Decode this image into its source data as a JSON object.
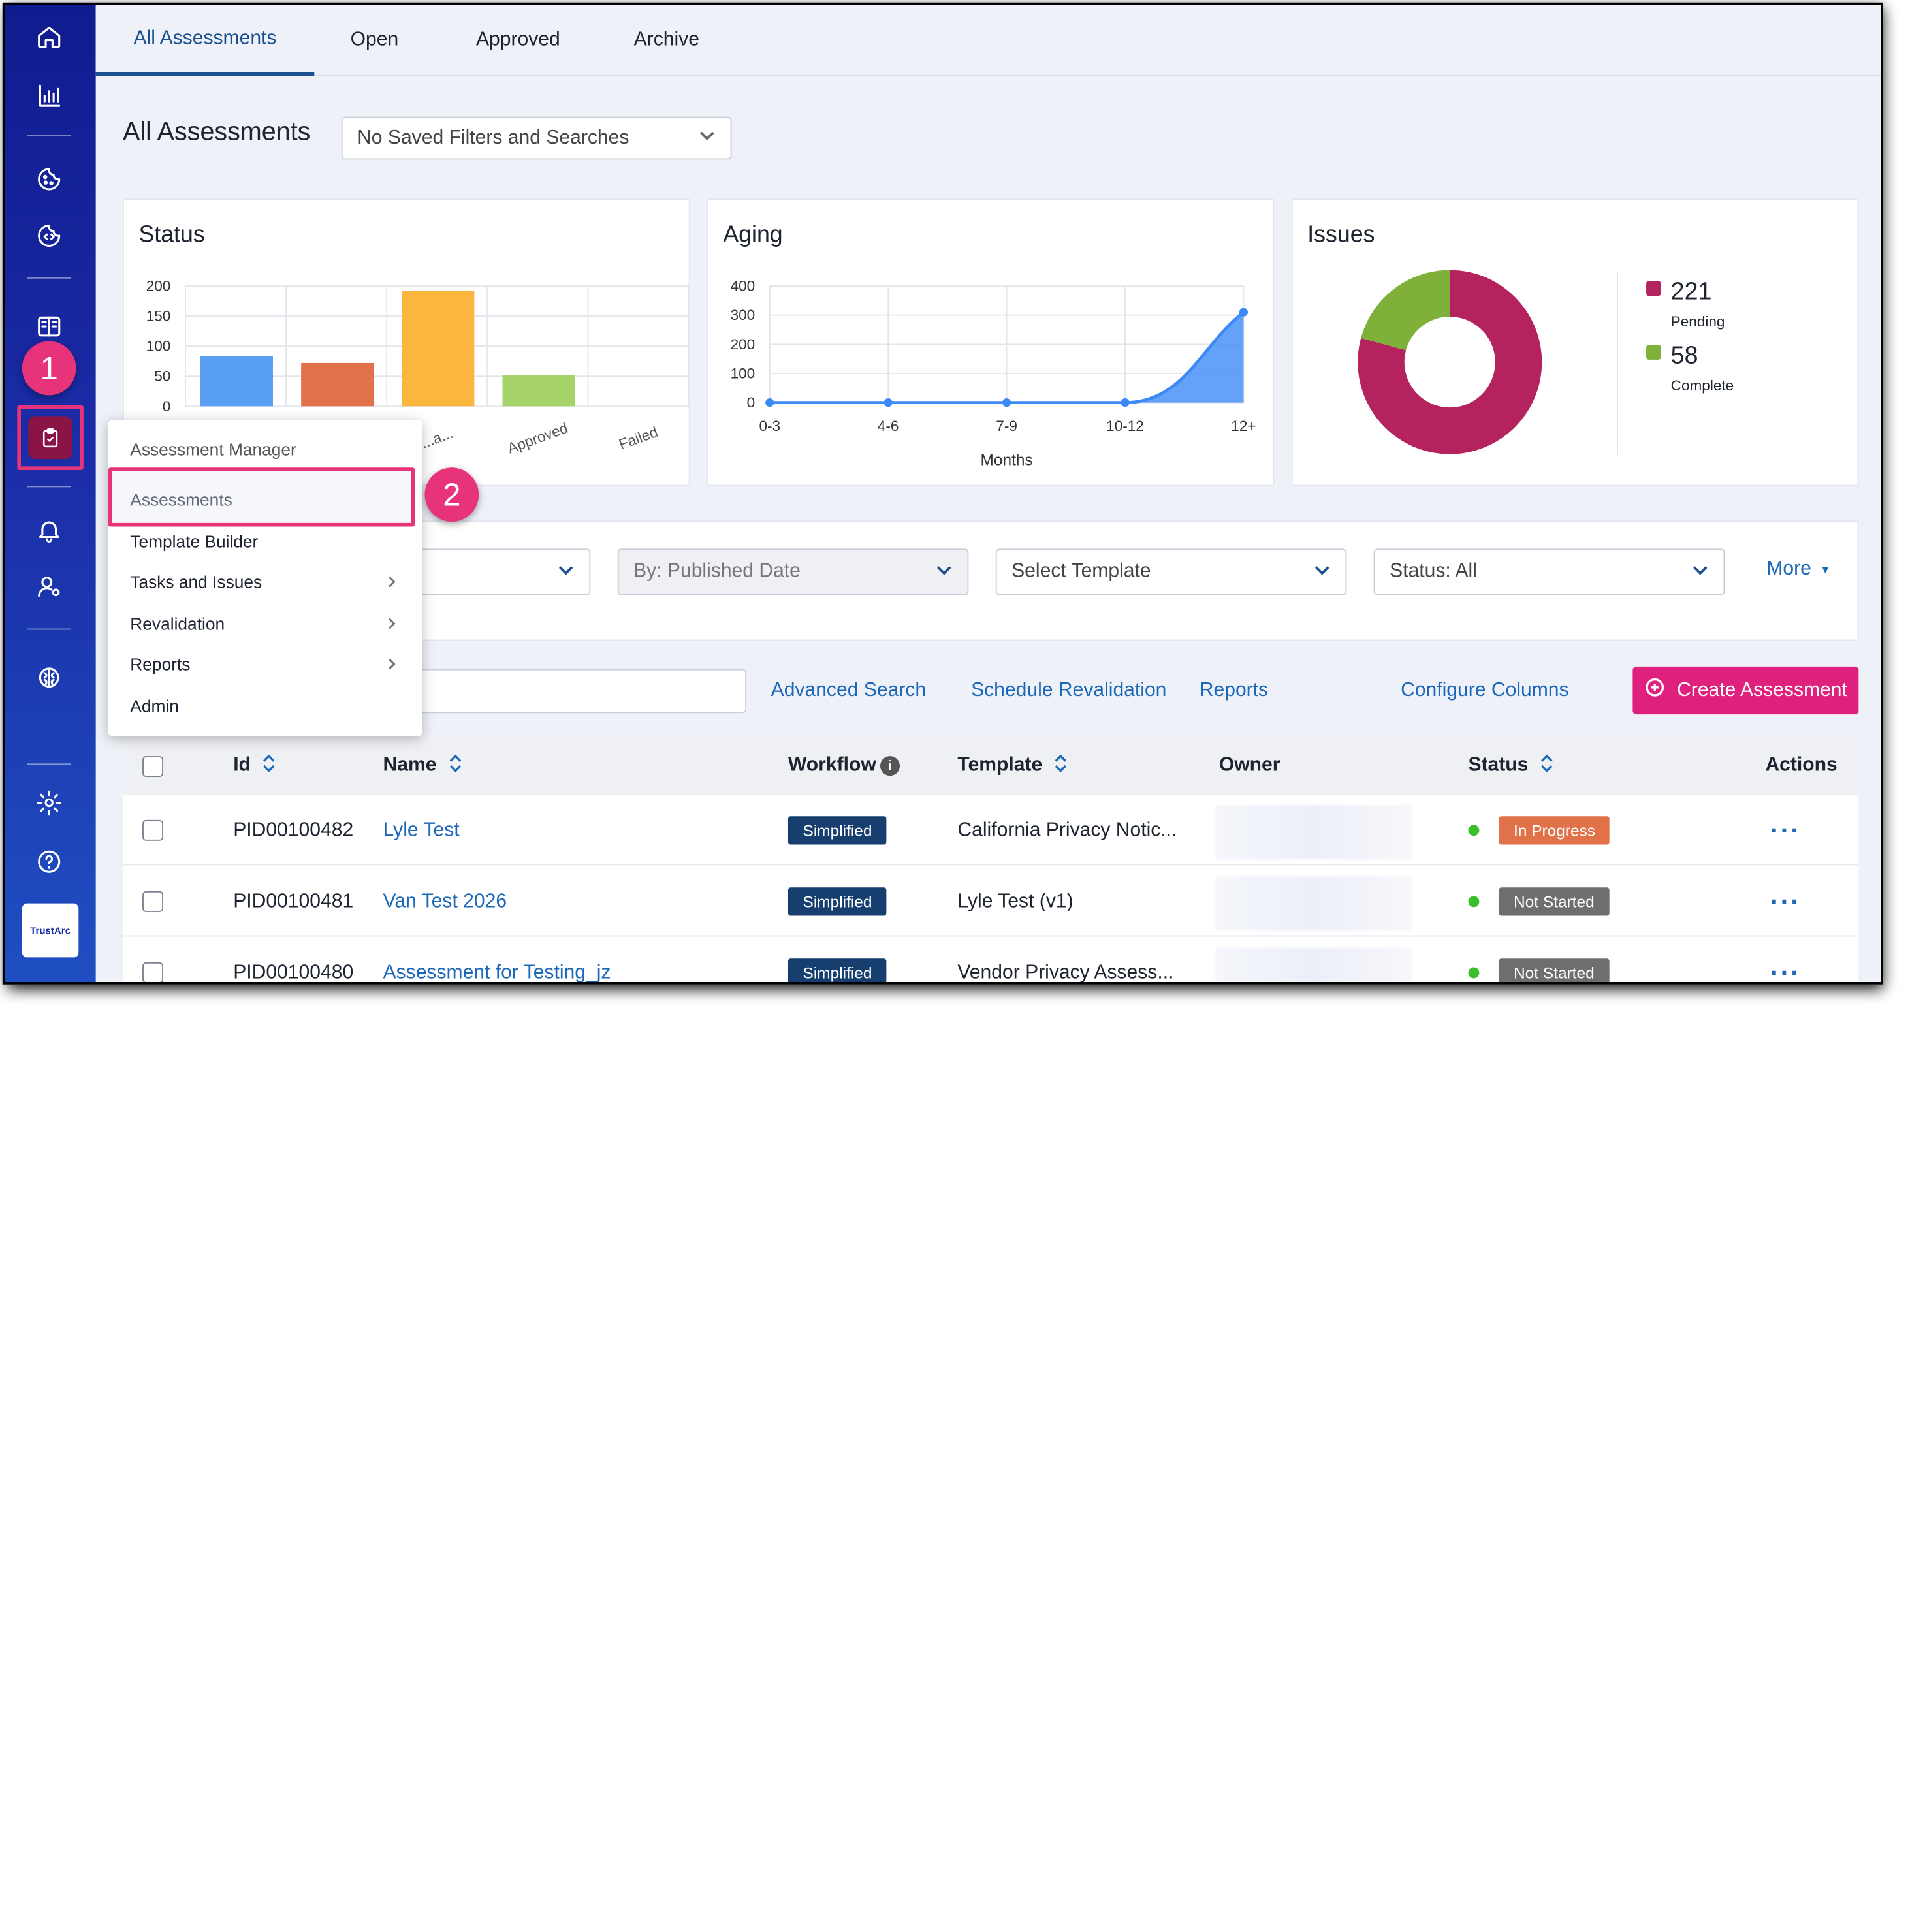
{
  "tabs": [
    {
      "label": "All Assessments"
    },
    {
      "label": "Open"
    },
    {
      "label": "Approved"
    },
    {
      "label": "Archive"
    }
  ],
  "page_title": "All Assessments",
  "saved_filter": {
    "value": "No Saved Filters and Searches"
  },
  "callouts": {
    "one": "1",
    "two": "2"
  },
  "logo_text": "TrustArc",
  "sidebar_icons": [
    "home-icon",
    "bar-chart-icon",
    "cookie-icon",
    "cookie-code-icon",
    "book-icon",
    "clipboard-check-icon",
    "bell-icon",
    "user-gear-icon",
    "brain-icon",
    "gear-icon",
    "help-icon"
  ],
  "cards": {
    "status": {
      "title": "Status"
    },
    "aging": {
      "title": "Aging"
    },
    "issues": {
      "title": "Issues",
      "pending_value": "221",
      "pending_label": "Pending",
      "complete_value": "58",
      "complete_label": "Complete",
      "pending_color": "#b5235e",
      "complete_color": "#7fb13a"
    }
  },
  "chart_data": [
    {
      "type": "bar",
      "title": "Status",
      "categories": [
        "",
        "",
        "...a...",
        "Approved",
        "Failed"
      ],
      "values": [
        83,
        72,
        192,
        52,
        0
      ],
      "colors": [
        "#5aa0f2",
        "#e07149",
        "#fbb640",
        "#a6d46a",
        "#cccccc"
      ],
      "ylim": [
        0,
        200
      ],
      "yticks": [
        "200",
        "150",
        "100",
        "50",
        "0"
      ],
      "grid": true
    },
    {
      "type": "area",
      "title": "Aging",
      "xlabel": "Months",
      "categories": [
        "0-3",
        "4-6",
        "7-9",
        "10-12",
        "12+"
      ],
      "values": [
        0,
        0,
        0,
        0,
        310
      ],
      "ylim": [
        0,
        400
      ],
      "yticks": [
        "400",
        "300",
        "200",
        "100",
        "0"
      ],
      "color": "#3d8af7",
      "grid": true
    },
    {
      "type": "pie",
      "title": "Issues",
      "labels": [
        "Pending",
        "Complete"
      ],
      "values": [
        221,
        58
      ],
      "colors": [
        "#b5235e",
        "#7fb13a"
      ]
    }
  ],
  "filters": {
    "first": {
      "value": ""
    },
    "date": {
      "value": "By: Published Date"
    },
    "template": {
      "value": "Select Template"
    },
    "status": {
      "value": "Status: All"
    },
    "more": "More"
  },
  "actions": {
    "advanced_search": "Advanced Search",
    "schedule_revalidation": "Schedule Revalidation",
    "reports": "Reports",
    "configure_columns": "Configure Columns",
    "create_assessment": "Create Assessment"
  },
  "table": {
    "headers": {
      "id": "Id",
      "name": "Name",
      "workflow": "Workflow",
      "template": "Template",
      "owner": "Owner",
      "status": "Status",
      "actions": "Actions"
    },
    "rows": [
      {
        "id": "PID00100482",
        "name": "Lyle Test",
        "workflow": "Simplified",
        "template": "California Privacy Notic...",
        "status": "In Progress",
        "status_color": "#e07149"
      },
      {
        "id": "PID00100481",
        "name": "Van Test 2026",
        "workflow": "Simplified",
        "template": "Lyle Test (v1)",
        "status": "Not Started",
        "status_color": "#6e6e6e"
      },
      {
        "id": "PID00100480",
        "name": "Assessment for Testing_jz",
        "workflow": "Simplified",
        "template": "Vendor Privacy Assess...",
        "status": "Not Started",
        "status_color": "#6e6e6e"
      }
    ]
  },
  "menu": {
    "header": "Assessment Manager",
    "items": [
      {
        "label": "Assessments",
        "submenu": false
      },
      {
        "label": "Template Builder",
        "submenu": false
      },
      {
        "label": "Tasks and Issues",
        "submenu": true
      },
      {
        "label": "Revalidation",
        "submenu": true
      },
      {
        "label": "Reports",
        "submenu": true
      },
      {
        "label": "Admin",
        "submenu": false
      }
    ]
  }
}
